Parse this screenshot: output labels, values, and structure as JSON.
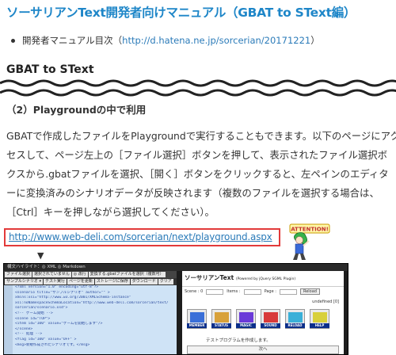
{
  "page": {
    "title": "ソーサリアンText開発者向けマニュアル（GBAT to SText編）",
    "toc_label": "開発者マニュアル目次（",
    "toc_link": "http://d.hatena.ne.jp/sorcerian/20171221",
    "toc_close": "）",
    "section_heading": "GBAT to SText",
    "subsection_heading": "（2）Playgroundの中で利用",
    "paragraph_lines": [
      "GBATで作成したファイルをPlaygroundで実行することもできます。以下のページにアク",
      "セスして、ページ左上の［ファイル選択］ボタンを押して、表示されたファイル選択ボ",
      "クスから.gbatファイルを選択、［開く］ボタンをクリックすると、左ペインのエディタ",
      "ーに変換済みのシナリオデータが反映されます（複数のファイルを選択する場合は、",
      "［Ctrl］キーを押しながら選択してください）。"
    ],
    "playground_url": "http://www.web-deli.com/sorcerian/next/playground.aspx",
    "arrow": "▼",
    "attention_label": "ATTENTION!",
    "colors": {
      "title": "#1e86c8",
      "link": "#2b7bb9",
      "highlight_border": "#e23a3a"
    }
  },
  "screenshot": {
    "topbar_text": "構文ハイライト：◎ XML  ◎ Markdown",
    "left_buttons": [
      "ファイル選択",
      "選択されていません",
      "◎ 改行",
      "変換する.gbatファイルを選択（複数可）"
    ],
    "left_tabs": [
      "サンプルシナリオ ▾",
      "テスト実行",
      "ページを更新",
      "ストレージに保存",
      "ダウンロード",
      "クリア"
    ],
    "code_lines": [
      "<?xml version=\"1.0\" encoding=\"utf-8\"?>",
      "<scenario title=\"サンプルシナリオ\" author=\"\" >",
      "  xmlns:xsi=\"http://www.w3.org/2001/XMLSchema-instance\"",
      "  xsi:noNamespaceSchemaLocation=\"http://www.web-deli.com/sorcerian/text/",
      "  sorcerian/scenario.xsd\">",
      "",
      "  <!-- ゲーム開始 -->",
      "  <scene id=\"TOP\">",
      "    <item id=\"100\" value=\"ゲームを開始します\"/>",
      "  </scene>",
      "",
      "  <!-- 処理 -->",
      "  <flag id=\"100\" value=\"OFF\" >",
      "    <msg>新規作成されたシナリオです。</msg>"
    ],
    "right_title": "ソーサリアンText",
    "right_title_sub": "(Powered by jQuery SGML Plugin)",
    "status": {
      "scene_label": "Scene : 0",
      "items_label": "Items :",
      "page_label": "Page :",
      "reload": "Reload"
    },
    "undefined_label": "undefined [0]",
    "icons": [
      {
        "label": "MEMBER",
        "color": "#3a6fd8"
      },
      {
        "label": "STATUS",
        "color": "#d8a13a"
      },
      {
        "label": "MAGIC",
        "color": "#6a3ad8"
      },
      {
        "label": "SOUND",
        "color": "#d83a3a"
      },
      {
        "label": "RELOAD",
        "color": "#3ab0d8"
      },
      {
        "label": "HELP",
        "color": "#d8d03a"
      }
    ],
    "right_message": "テストプログラムを作成します。",
    "next_button": "次へ"
  }
}
